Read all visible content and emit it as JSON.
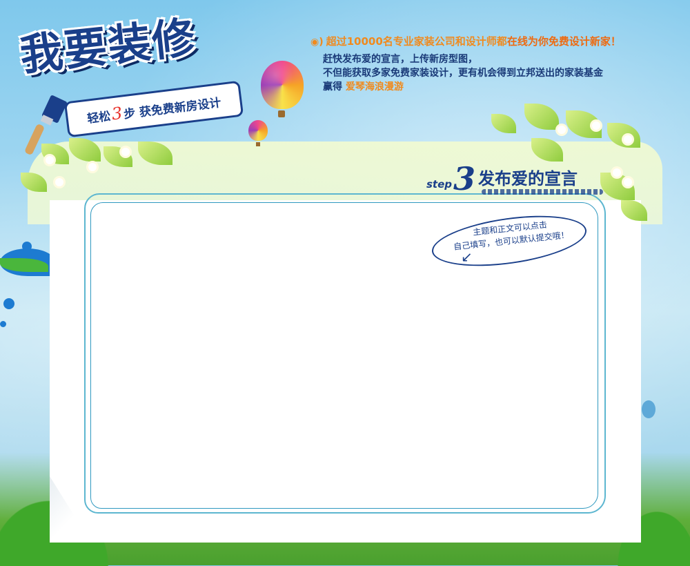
{
  "header": {
    "title": "我要装修",
    "ribbon_prefix": "轻松",
    "ribbon_number": "3",
    "ribbon_suffix": "步 获免费新房设计"
  },
  "info": {
    "speaker_icon": "speaker-icon",
    "line1_a": "超过10000名专业家装公司和设计师都",
    "line1_b": "在线为你免费设计新家！",
    "line2": "赶快发布爱的宣言，上传新房型图，",
    "line3": "不但能获取多家免费家装设计，更有机会得到立邦送出的家装基金",
    "line4_a": "赢得",
    "line4_b": "爱琴海浪漫游"
  },
  "step": {
    "word": "step",
    "number": "3",
    "title": "发布爱的宣言"
  },
  "tip": {
    "line1": "主题和正文可以点击",
    "line2": "自己填写，也可以默认提交哦！"
  },
  "colors": {
    "brand_blue": "#1a3f8a",
    "accent_orange": "#f08a1e",
    "frame": "#2e98bf"
  }
}
